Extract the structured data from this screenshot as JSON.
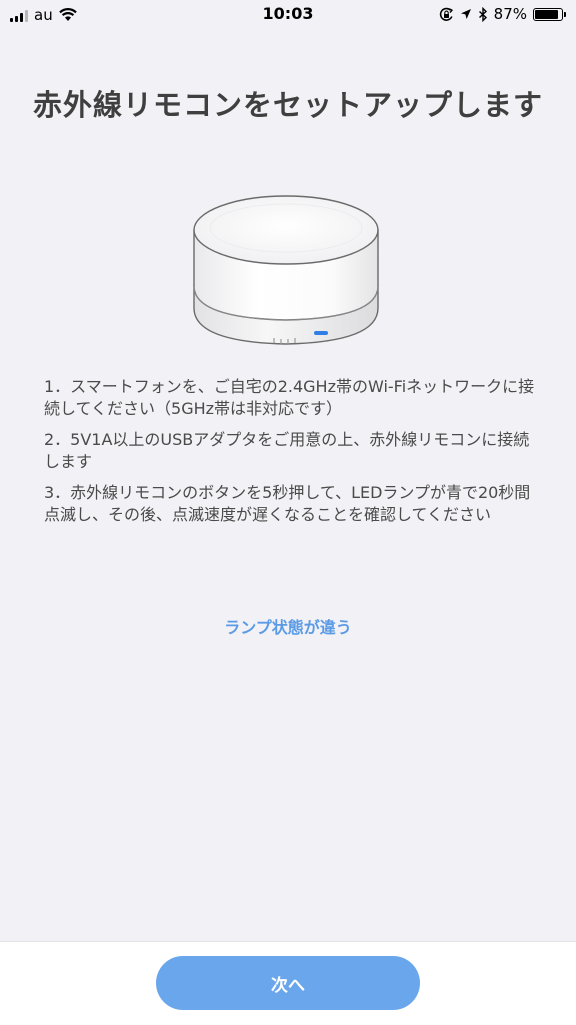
{
  "status_bar": {
    "carrier": "au",
    "time": "10:03",
    "battery": "87%",
    "battery_level": 0.87,
    "icons": [
      "signal-icon",
      "wifi-icon",
      "orientation-lock-icon",
      "location-icon",
      "bluetooth-icon",
      "battery-icon"
    ]
  },
  "page": {
    "title": "赤外線リモコンをセットアップします",
    "device_image": "ir-remote-hub-device",
    "steps": [
      "1．スマートフォンを、ご自宅の2.4GHz帯のWi-Fiネットワークに接続してください（5GHz帯は非対応です）",
      "2．5V1A以上のUSBアダプタをご用意の上、赤外線リモコンに接続します",
      "3．赤外線リモコンのボタンを5秒押して、LEDランプが青で20秒間点滅し、その後、点滅速度が遅くなることを確認してください"
    ],
    "lamp_link": "ランプ状態が違う"
  },
  "footer": {
    "next_label": "次へ"
  },
  "colors": {
    "background": "#f2f2f6",
    "accent": "#5b9be6",
    "button": "#6aa6ec",
    "led": "#2f7fe6"
  }
}
